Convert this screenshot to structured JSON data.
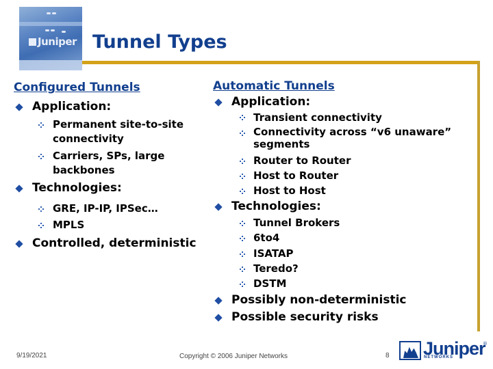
{
  "slide": {
    "title": "Tunnel Types",
    "header_image": "juniper-router-photo",
    "accent_color": "#d4a219",
    "title_color": "#123f8e"
  },
  "left": {
    "heading": "Configured Tunnels",
    "items": [
      {
        "label": "Application:",
        "subitems": [
          "Permanent site-to-site connectivity",
          "Carriers, SPs, large backbones"
        ]
      },
      {
        "label": "Technologies:",
        "subitems": [
          "GRE, IP-IP, IPSec…",
          "MPLS"
        ]
      },
      {
        "label": "Controlled, deterministic",
        "subitems": []
      }
    ]
  },
  "right": {
    "heading": "Automatic Tunnels",
    "items": [
      {
        "label": "Application:",
        "subitems": [
          "Transient connectivity",
          "Connectivity across “v6 unaware” segments",
          "Router to Router",
          "Host to Router",
          "Host to Host"
        ]
      },
      {
        "label": "Technologies:",
        "subitems": [
          "Tunnel Brokers",
          "6to4",
          "ISATAP",
          "Teredo?",
          "DSTM"
        ]
      },
      {
        "label": "Possibly non-deterministic",
        "subitems": []
      },
      {
        "label": "Possible security risks",
        "subitems": []
      }
    ]
  },
  "footer": {
    "date": "9/19/2021",
    "copyright": "Copyright © 2006 Juniper Networks",
    "page_number": "8",
    "logo_word": "Juniper",
    "logo_sub": "NETWORKS",
    "logo_reg": "®",
    "photo_logo_word": "Juniper"
  }
}
